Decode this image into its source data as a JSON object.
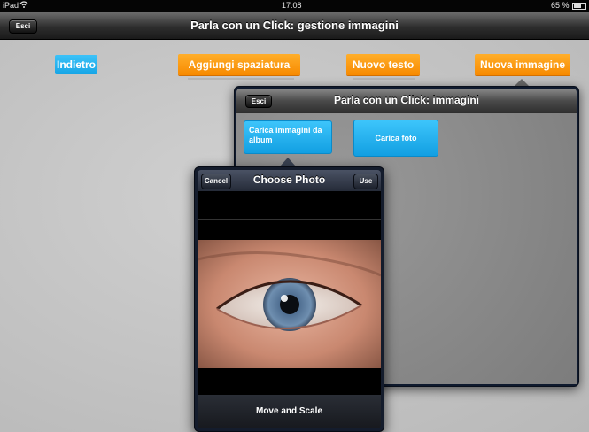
{
  "status_bar": {
    "device": "iPad",
    "wifi_icon": "wifi-icon",
    "time": "17:08",
    "battery": "65 %",
    "battery_icon": "battery-icon"
  },
  "main_header": {
    "exit_label": "Esci",
    "title": "Parla con un Click: gestione immagini"
  },
  "toolbar": {
    "back_label": "Indietro",
    "add_spacing_label": "Aggiungi spaziatura",
    "new_text_label": "Nuovo testo",
    "new_image_label": "Nuova immagine"
  },
  "images_popover": {
    "exit_label": "Esci",
    "title": "Parla con un Click: immagini",
    "load_album_label": "Carica immagini da album",
    "load_photo_label": "Carica foto"
  },
  "choose_photo": {
    "cancel_label": "Cancel",
    "title": "Choose Photo",
    "use_label": "Use",
    "footer_label": "Move and Scale"
  },
  "colors": {
    "orange": "#f78a00",
    "blue": "#16a5e6",
    "dark_navy": "#0f1a2e"
  }
}
